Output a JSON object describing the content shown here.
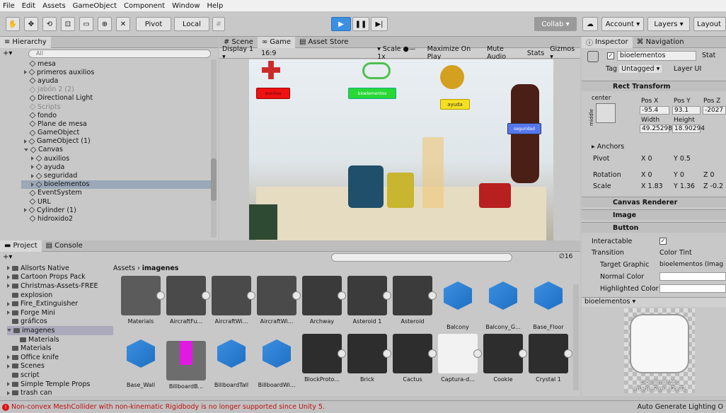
{
  "menu": [
    "File",
    "Edit",
    "Assets",
    "GameObject",
    "Component",
    "Window",
    "Help"
  ],
  "toolbar": {
    "pivot": "Pivot",
    "local": "Local",
    "collab": "Collab",
    "account": "Account",
    "layers": "Layers",
    "layout": "Layout"
  },
  "hierarchy": {
    "title": "Hierarchy",
    "search_placeholder": "All",
    "items": [
      "mesa",
      "primeros auxilios",
      "ayuda",
      "jabón 2 (2)",
      "Directional Light",
      "Scripts",
      "fondo",
      "Plane de mesa",
      "GameObject",
      "GameObject (1)",
      "Canvas",
      "auxilios",
      "ayuda",
      "seguridad",
      "bioelementos",
      "EventSystem",
      "URL",
      "Cylinder (1)",
      "hidroxido2"
    ]
  },
  "game": {
    "tabs": [
      "Scene",
      "Game",
      "Asset Store"
    ],
    "display": "Display 1",
    "aspect": "16:9",
    "scale_label": "Scale",
    "scale_value": "1x",
    "maximize": "Maximize On Play",
    "mute": "Mute Audio",
    "stats": "Stats",
    "gizmos": "Gizmos",
    "buttons": {
      "auxilios": "auxilios",
      "bio": "bioelementos",
      "ayuda": "ayuda",
      "seguridad": "seguridad"
    }
  },
  "inspector": {
    "tabs": [
      "Inspector",
      "Navigation"
    ],
    "object_name": "bioelementos",
    "static": "Stat",
    "tag_label": "Tag",
    "tag": "Untagged",
    "layer_label": "Layer",
    "layer": "UI",
    "rect": {
      "title": "Rect Transform",
      "anchor": "center",
      "side": "middle",
      "posx_l": "Pos X",
      "posy_l": "Pos Y",
      "posz_l": "Pos Z",
      "posx": "-95.4",
      "posy": "93.1",
      "posz": "-2027",
      "w_l": "Width",
      "h_l": "Height",
      "w": "49.25298",
      "h": "18.90294",
      "anchors": "Anchors",
      "pivot": "Pivot",
      "px": "0",
      "py": "0.5",
      "rotation": "Rotation",
      "rx": "0",
      "ry": "0",
      "rz": "0",
      "scale": "Scale",
      "sx": "1.83",
      "sy": "1.36",
      "sz": "-0.2"
    },
    "canvas_renderer": "Canvas Renderer",
    "image": "Image",
    "button": "Button",
    "interactable": "Interactable",
    "transition": "Transition",
    "transition_val": "Color Tint",
    "target_graphic": "Target Graphic",
    "target_val": "bioelementos (Imag",
    "normal": "Normal Color",
    "highlighted": "Highlighted Color",
    "preview_title": "bioelementos",
    "preview_name": "bioelementos",
    "preview_size": "Image Size: 32x32"
  },
  "project": {
    "tabs": [
      "Project",
      "Console"
    ],
    "breadcrumb_root": "Assets",
    "breadcrumb_leaf": "imagenes",
    "count": "16",
    "folders": [
      "Allsorts Native",
      "Cartoon Props Pack",
      "Christmas-Assets-FREE",
      "explosion",
      "Fire_Extinguisher",
      "Forge Mini",
      "gráficos",
      "imagenes",
      "Materials",
      "Materials",
      "Office knife",
      "Scenes",
      "script",
      "Simple Temple Props",
      "trash can"
    ],
    "assets_row1": [
      "Materials",
      "AircraftFu...",
      "AircraftWi...",
      "AircraftWi...",
      "Archway",
      "Asteroid 1",
      "Asteroid",
      "Balcony",
      "Balcony_G...",
      "Base_Floor"
    ],
    "assets_row2": [
      "Base_Wall",
      "BillboardB...",
      "BillboardTall",
      "BillboardWi...",
      "BlockProto...",
      "Brick",
      "Cactus",
      "Captura-d...",
      "Cookie",
      "Crystal 1"
    ]
  },
  "status": {
    "error": "Non-convex MeshCollider with non-kinematic Rigidbody is no longer supported since Unity 5.",
    "right": "Auto Generate Lighting O"
  }
}
